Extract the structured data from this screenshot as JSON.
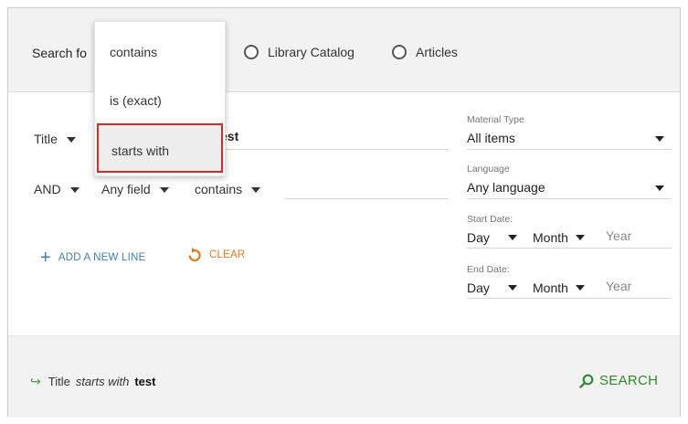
{
  "search_bar": {
    "label": "Search fo",
    "scopes": [
      "Library Catalog",
      "Articles"
    ]
  },
  "dropdown": {
    "items": [
      "contains",
      "is (exact)",
      "starts with"
    ],
    "highlighted": "starts with"
  },
  "row1": {
    "field": "Title",
    "term_fragment": "est"
  },
  "row2": {
    "operator": "AND",
    "field": "Any field",
    "condition": "contains"
  },
  "actions": {
    "add_line": "ADD A NEW LINE",
    "clear": "CLEAR"
  },
  "filters": {
    "material_type_label": "Material Type",
    "material_type_value": "All items",
    "language_label": "Language",
    "language_value": "Any language",
    "start_date_label": "Start Date:",
    "end_date_label": "End Date:",
    "day": "Day",
    "month": "Month",
    "year": "Year"
  },
  "summary": {
    "field": "Title",
    "operator": "starts with",
    "term": "test"
  },
  "search_button": "SEARCH",
  "colors": {
    "accent_blue": "#3f7fb5",
    "accent_orange": "#e07b1a",
    "accent_green": "#2e8b2e",
    "highlight_border": "#d42a2a"
  }
}
